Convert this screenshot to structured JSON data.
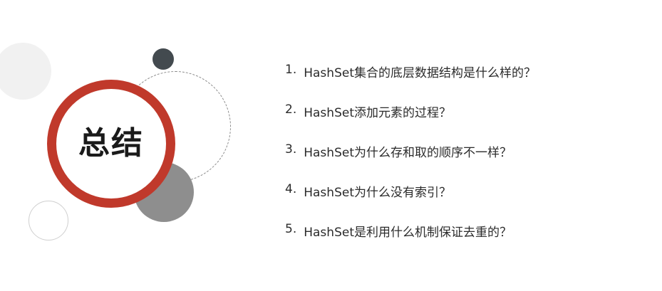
{
  "title": "总结",
  "items": [
    {
      "number": "1.",
      "text": "HashSet集合的底层数据结构是什么样的？"
    },
    {
      "number": "2.",
      "text": "HashSet添加元素的过程？"
    },
    {
      "number": "3.",
      "text": "HashSet为什么存和取的顺序不一样？"
    },
    {
      "number": "4.",
      "text": "HashSet为什么没有索引？"
    },
    {
      "number": "5.",
      "text": "HashSet是利用什么机制保证去重的？"
    }
  ],
  "colors": {
    "accent": "#c0392b",
    "dark_dot": "#434a4f",
    "gray_disc": "#8e8e8e",
    "light_disc": "#f1f1f1",
    "text": "#2b2b2b"
  }
}
